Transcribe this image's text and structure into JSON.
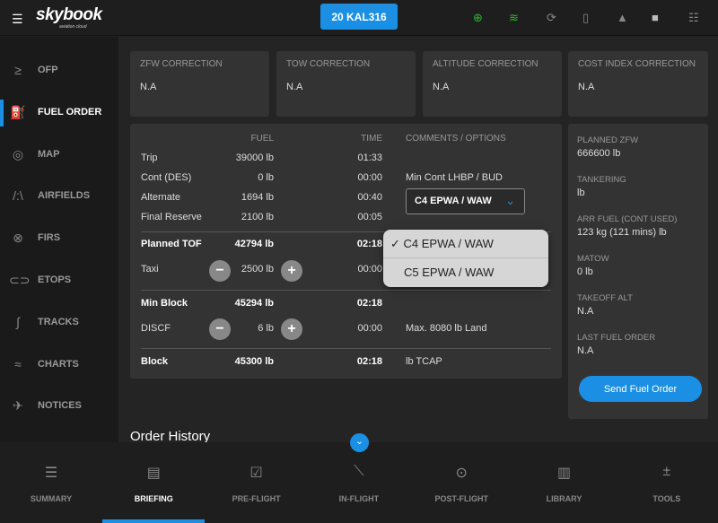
{
  "header": {
    "logo": "skybook",
    "logo_sub": "aviation cloud",
    "flight_button": "20 KAL316",
    "icons": [
      "download-icon",
      "wifi-icon",
      "sync-icon",
      "bookmark-icon",
      "bell-icon",
      "camera-icon",
      "settings-sliders-icon"
    ]
  },
  "sidebar": {
    "items": [
      {
        "label": "OFP",
        "icon": "ofp-icon"
      },
      {
        "label": "FUEL ORDER",
        "icon": "fuel-pump-icon",
        "active": true
      },
      {
        "label": "MAP",
        "icon": "map-icon"
      },
      {
        "label": "AIRFIELDS",
        "icon": "airfield-icon"
      },
      {
        "label": "FIRS",
        "icon": "firs-icon"
      },
      {
        "label": "ETOPS",
        "icon": "etops-icon"
      },
      {
        "label": "TRACKS",
        "icon": "tracks-icon"
      },
      {
        "label": "CHARTS",
        "icon": "charts-icon"
      },
      {
        "label": "NOTICES",
        "icon": "notices-icon"
      }
    ]
  },
  "corrections": [
    {
      "label": "ZFW CORRECTION",
      "value": "N.A"
    },
    {
      "label": "TOW CORRECTION",
      "value": "N.A"
    },
    {
      "label": "ALTITUDE CORRECTION",
      "value": "N.A"
    },
    {
      "label": "COST INDEX CORRECTION",
      "value": "N.A"
    }
  ],
  "fuel_table": {
    "headers": {
      "fuel": "FUEL",
      "time": "TIME",
      "comments": "COMMENTS / OPTIONS"
    },
    "rows": [
      {
        "label": "Trip",
        "fuel": "39000 lb",
        "time": "01:33",
        "comment": ""
      },
      {
        "label": "Cont (DES)",
        "fuel": "0 lb",
        "time": "00:00",
        "comment": "Min Cont LHBP / BUD"
      },
      {
        "label": "Alternate",
        "fuel": "1694 lb",
        "time": "00:40",
        "comment": ""
      },
      {
        "label": "Final Reserve",
        "fuel": "2100 lb",
        "time": "00:05",
        "comment": ""
      },
      {
        "label": "Planned TOF",
        "fuel": "42794 lb",
        "time": "02:18",
        "comment": ""
      },
      {
        "label": "Taxi",
        "fuel": "2500 lb",
        "time": "00:00",
        "comment": ""
      },
      {
        "label": "Min Block",
        "fuel": "45294 lb",
        "time": "02:18",
        "comment": ""
      },
      {
        "label": "DISCF",
        "fuel": "6 lb",
        "time": "00:00",
        "comment": "Max. 8080 lb Land"
      },
      {
        "label": "Block",
        "fuel": "45300 lb",
        "time": "02:18",
        "comment": "lb TCAP"
      }
    ],
    "alternate_select": {
      "value": "C4 EPWA / WAW",
      "options": [
        "C4 EPWA / WAW",
        "C5 EPWA / WAW"
      ],
      "selected": "C4 EPWA / WAW"
    }
  },
  "summary": [
    {
      "label": "PLANNED ZFW",
      "value": "666600 lb"
    },
    {
      "label": "TANKERING",
      "value": "lb"
    },
    {
      "label": "ARR FUEL (CONT USED)",
      "value": "123 kg (121 mins) lb"
    },
    {
      "label": "MATOW",
      "value": "0 lb"
    },
    {
      "label": "TAKEOFF ALT",
      "value": "N.A"
    },
    {
      "label": "LAST FUEL ORDER",
      "value": "N.A"
    }
  ],
  "send_button": "Send Fuel Order",
  "order_history_title": "Order History",
  "bottom_nav": [
    {
      "label": "SUMMARY"
    },
    {
      "label": "BRIEFING",
      "active": true
    },
    {
      "label": "PRE-FLIGHT"
    },
    {
      "label": "IN-FLIGHT"
    },
    {
      "label": "POST-FLIGHT"
    },
    {
      "label": "LIBRARY"
    },
    {
      "label": "TOOLS"
    }
  ],
  "colors": {
    "accent": "#1a8fe3",
    "status_green": "#2db82d"
  }
}
